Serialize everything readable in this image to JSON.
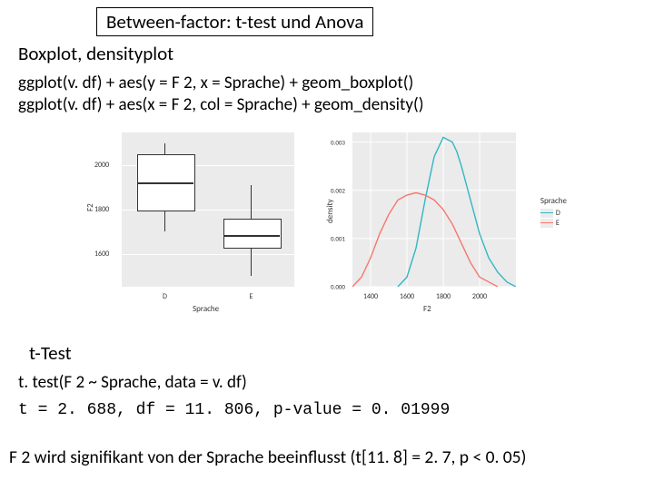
{
  "title": "Between-factor: t-test und Anova",
  "subtitle": "Boxplot, densityplot",
  "code": {
    "line1": "ggplot(v. df) + aes(y = F 2, x = Sprache) + geom_boxplot()",
    "line2": "ggplot(v. df) + aes(x = F 2, col = Sprache) + geom_density()"
  },
  "ttest": {
    "label": "t-Test",
    "call": "t. test(F 2 ~ Sprache, data = v. df)",
    "output": "t = 2. 688, df = 11. 806, p-value = 0. 01999"
  },
  "conclusion": "F 2 wird signifikant von der Sprache beeinflusst (t[11. 8] = 2. 7, p < 0. 05)",
  "chart_data": [
    {
      "type": "boxplot",
      "xlabel": "Sprache",
      "ylabel": "F2",
      "yticks": [
        1600,
        1800,
        2000
      ],
      "categories": [
        "D",
        "E"
      ],
      "series": [
        {
          "name": "D",
          "min": 1700,
          "q1": 1800,
          "median": 1920,
          "q3": 2050,
          "max": 2100
        },
        {
          "name": "E",
          "min": 1500,
          "q1": 1630,
          "median": 1680,
          "q3": 1760,
          "max": 1910
        }
      ],
      "ylim": [
        1450,
        2150
      ]
    },
    {
      "type": "density",
      "xlabel": "F2",
      "ylabel": "density",
      "xticks": [
        1400,
        1600,
        1800,
        2000
      ],
      "yticks": [
        0.0,
        0.001,
        0.002,
        0.003
      ],
      "xlim": [
        1300,
        2200
      ],
      "ylim": [
        0,
        0.0032
      ],
      "legend": {
        "title": "Sprache",
        "items": [
          "D",
          "E"
        ]
      },
      "series": [
        {
          "name": "D",
          "color": "#31b6c4",
          "x": [
            1550,
            1600,
            1650,
            1700,
            1750,
            1800,
            1850,
            1875,
            1900,
            1950,
            2000,
            2050,
            2100,
            2150,
            2200
          ],
          "y": [
            0.0,
            0.0002,
            0.0008,
            0.0018,
            0.0027,
            0.0031,
            0.003,
            0.0028,
            0.0025,
            0.0018,
            0.0011,
            0.0006,
            0.0003,
            0.0001,
            0.0
          ]
        },
        {
          "name": "E",
          "color": "#f7766c",
          "x": [
            1300,
            1350,
            1400,
            1450,
            1500,
            1550,
            1600,
            1650,
            1700,
            1750,
            1800,
            1850,
            1900,
            1950,
            2000,
            2050,
            2100
          ],
          "y": [
            0.0,
            0.0002,
            0.0006,
            0.0011,
            0.0015,
            0.0018,
            0.0019,
            0.00195,
            0.0019,
            0.0018,
            0.0016,
            0.0013,
            0.0009,
            0.0005,
            0.0002,
            0.0001,
            0.0
          ]
        }
      ]
    }
  ]
}
